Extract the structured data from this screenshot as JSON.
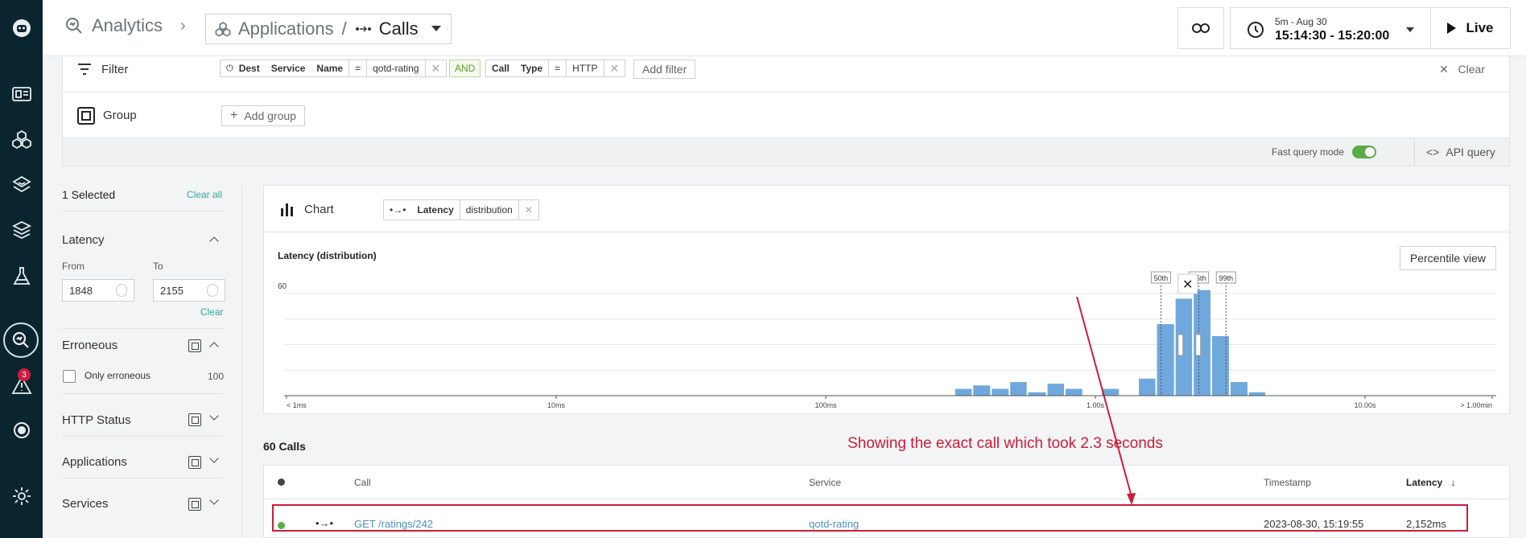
{
  "topbar": {
    "breadcrumb_root": "Analytics",
    "app_name": "Applications",
    "separator": "/",
    "current": "Calls",
    "time_small": "5m - Aug 30",
    "time_big": "15:14:30 - 15:20:00",
    "live_label": "Live"
  },
  "filter": {
    "label": "Filter",
    "chip1": {
      "entity": "Dest",
      "key1": "Service",
      "key2": "Name",
      "op": "=",
      "value": "qotd-rating"
    },
    "and_label": "AND",
    "chip2": {
      "key1": "Call",
      "key2": "Type",
      "op": "=",
      "value": "HTTP"
    },
    "add_filter": "Add filter",
    "clear": "Clear"
  },
  "group": {
    "label": "Group",
    "add_group": "Add group"
  },
  "options": {
    "fast_query": "Fast query mode",
    "api_query": "API query"
  },
  "sidebar": {
    "selected": "1 Selected",
    "clear_all": "Clear all",
    "latency": {
      "title": "Latency",
      "from_label": "From",
      "to_label": "To",
      "from_value": "1848",
      "to_value": "2155",
      "clear": "Clear"
    },
    "erroneous": {
      "title": "Erroneous",
      "only_label": "Only erroneous",
      "count": "100"
    },
    "http_status": "HTTP Status",
    "applications": "Applications",
    "services": "Services"
  },
  "chart_card": {
    "label": "Chart",
    "metric": "Latency",
    "aggregation": "distribution",
    "percentile_view": "Percentile view"
  },
  "chart_data": {
    "type": "bar",
    "title": "Latency (distribution)",
    "y_tick": "60",
    "x_scale": "log",
    "x_tick_labels": [
      "< 1ms",
      "10ms",
      "100ms",
      "1.00s",
      "10.00s",
      "> 1.00min"
    ],
    "bins_seconds": [
      0.3,
      0.35,
      0.41,
      0.48,
      0.56,
      0.66,
      0.77,
      0.9,
      1.05,
      1.23,
      1.44,
      1.68,
      1.97,
      2.3,
      2.69,
      3.15,
      3.69
    ],
    "counts": [
      4,
      6,
      4,
      8,
      2,
      7,
      4,
      0,
      4,
      0,
      10,
      42,
      57,
      62,
      35,
      8,
      2
    ],
    "percentile_markers": [
      "50th",
      "95th",
      "99th"
    ],
    "bar_color": "#6fa8dc"
  },
  "calls": {
    "count_label": "60 Calls",
    "annotation": "Showing the exact call which took 2.3 seconds",
    "columns": {
      "call": "Call",
      "service": "Service",
      "timestamp": "Timestamp",
      "latency": "Latency"
    },
    "rows": [
      {
        "call": "GET /ratings/242",
        "service": "qotd-rating",
        "timestamp": "2023-08-30, 15:19:55",
        "latency": "2,152ms",
        "status_color": "#5aac44"
      }
    ]
  },
  "nav": {
    "alert_count": "3"
  }
}
